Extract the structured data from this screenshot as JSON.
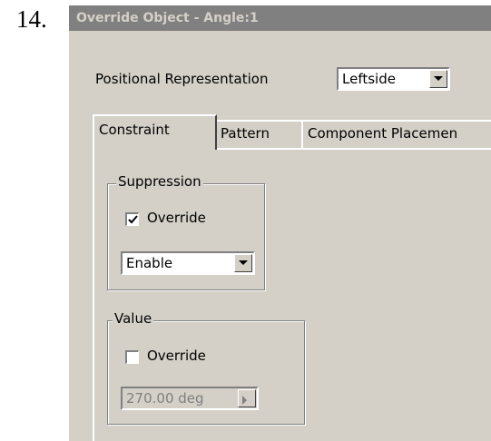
{
  "step_number": "14.",
  "dialog": {
    "title": "Override Object - Angle:1",
    "positional_representation": {
      "label": "Positional Representation",
      "selected": "Leftside"
    },
    "tabs": [
      {
        "label": "Constraint",
        "active": true
      },
      {
        "label": "Pattern",
        "active": false
      },
      {
        "label": "Component Placemen",
        "active": false
      }
    ],
    "suppression": {
      "label": "Suppression",
      "override_label": "Override",
      "override_checked": true,
      "selected": "Enable"
    },
    "value": {
      "label": "Value",
      "override_label": "Override",
      "override_checked": false,
      "field_value": "270.00 deg"
    }
  },
  "colors": {
    "dialog_face": "#d4d0c8",
    "titlebar": "#808080",
    "titlebar_text": "#d4d0c8",
    "disabled_text": "#808080"
  },
  "icons": [
    "dropdown-arrow-icon",
    "checkmark-icon",
    "spinner-arrow-icon"
  ]
}
